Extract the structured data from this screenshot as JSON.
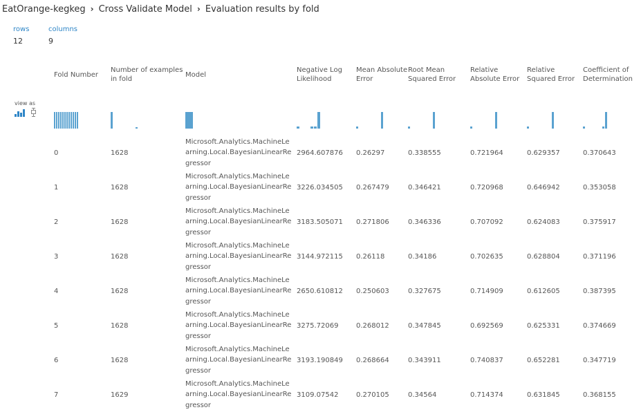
{
  "breadcrumb": {
    "items": [
      "EatOrange-kegkeg",
      "Cross Validate Model",
      "Evaluation results by fold"
    ]
  },
  "stats": {
    "rows_label": "rows",
    "rows_value": "12",
    "columns_label": "columns",
    "columns_value": "9"
  },
  "view_as": {
    "label": "view as",
    "icons": [
      "histogram-icon",
      "boxplot-icon"
    ]
  },
  "accent_color": "#2f86c7",
  "bar_color": "#5aa2d0",
  "table": {
    "headers": [
      "Fold Number",
      "Number of examples in fold",
      "Model",
      "Negative Log Likelihood",
      "Mean Absolute Error",
      "Root Mean Squared Error",
      "Relative Absolute Error",
      "Relative Squared Error",
      "Coefficient of Determination"
    ],
    "rows": [
      [
        "0",
        "1628",
        "Microsoft.Analytics.MachineLearning.Local.BayesianLinearRegressor",
        "2964.607876",
        "0.26297",
        "0.338555",
        "0.721964",
        "0.629357",
        "0.370643"
      ],
      [
        "1",
        "1628",
        "Microsoft.Analytics.MachineLearning.Local.BayesianLinearRegressor",
        "3226.034505",
        "0.267479",
        "0.346421",
        "0.720968",
        "0.646942",
        "0.353058"
      ],
      [
        "2",
        "1628",
        "Microsoft.Analytics.MachineLearning.Local.BayesianLinearRegressor",
        "3183.505071",
        "0.271806",
        "0.346336",
        "0.707092",
        "0.624083",
        "0.375917"
      ],
      [
        "3",
        "1628",
        "Microsoft.Analytics.MachineLearning.Local.BayesianLinearRegressor",
        "3144.972115",
        "0.26118",
        "0.34186",
        "0.702635",
        "0.628804",
        "0.371196"
      ],
      [
        "4",
        "1628",
        "Microsoft.Analytics.MachineLearning.Local.BayesianLinearRegressor",
        "2650.610812",
        "0.250603",
        "0.327675",
        "0.714909",
        "0.612605",
        "0.387395"
      ],
      [
        "5",
        "1628",
        "Microsoft.Analytics.MachineLearning.Local.BayesianLinearRegressor",
        "3275.72069",
        "0.268012",
        "0.347845",
        "0.692569",
        "0.625331",
        "0.374669"
      ],
      [
        "6",
        "1628",
        "Microsoft.Analytics.MachineLearning.Local.BayesianLinearRegressor",
        "3193.190849",
        "0.268664",
        "0.343911",
        "0.740837",
        "0.652281",
        "0.347719"
      ],
      [
        "7",
        "1629",
        "Microsoft.Analytics.MachineLearning.Local.BayesianLinearRegressor",
        "3109.07542",
        "0.270105",
        "0.34564",
        "0.714374",
        "0.631845",
        "0.368155"
      ]
    ]
  },
  "column_histograms": [
    [
      1,
      1,
      1,
      1,
      1,
      1,
      1,
      1,
      1,
      1,
      1,
      1
    ],
    [
      10,
      0,
      0,
      0,
      0,
      0,
      0,
      0,
      0,
      1
    ],
    [
      1
    ],
    [
      1,
      0,
      0,
      0,
      1,
      1,
      8
    ],
    [
      1,
      0,
      0,
      0,
      0,
      0,
      0,
      0,
      0,
      8
    ],
    [
      1,
      0,
      0,
      0,
      0,
      0,
      0,
      0,
      0,
      8
    ],
    [
      1,
      0,
      0,
      0,
      0,
      0,
      0,
      0,
      0,
      8
    ],
    [
      1,
      0,
      0,
      0,
      0,
      0,
      0,
      0,
      0,
      8
    ],
    [
      1,
      0,
      0,
      0,
      0,
      0,
      0,
      1,
      8
    ]
  ]
}
